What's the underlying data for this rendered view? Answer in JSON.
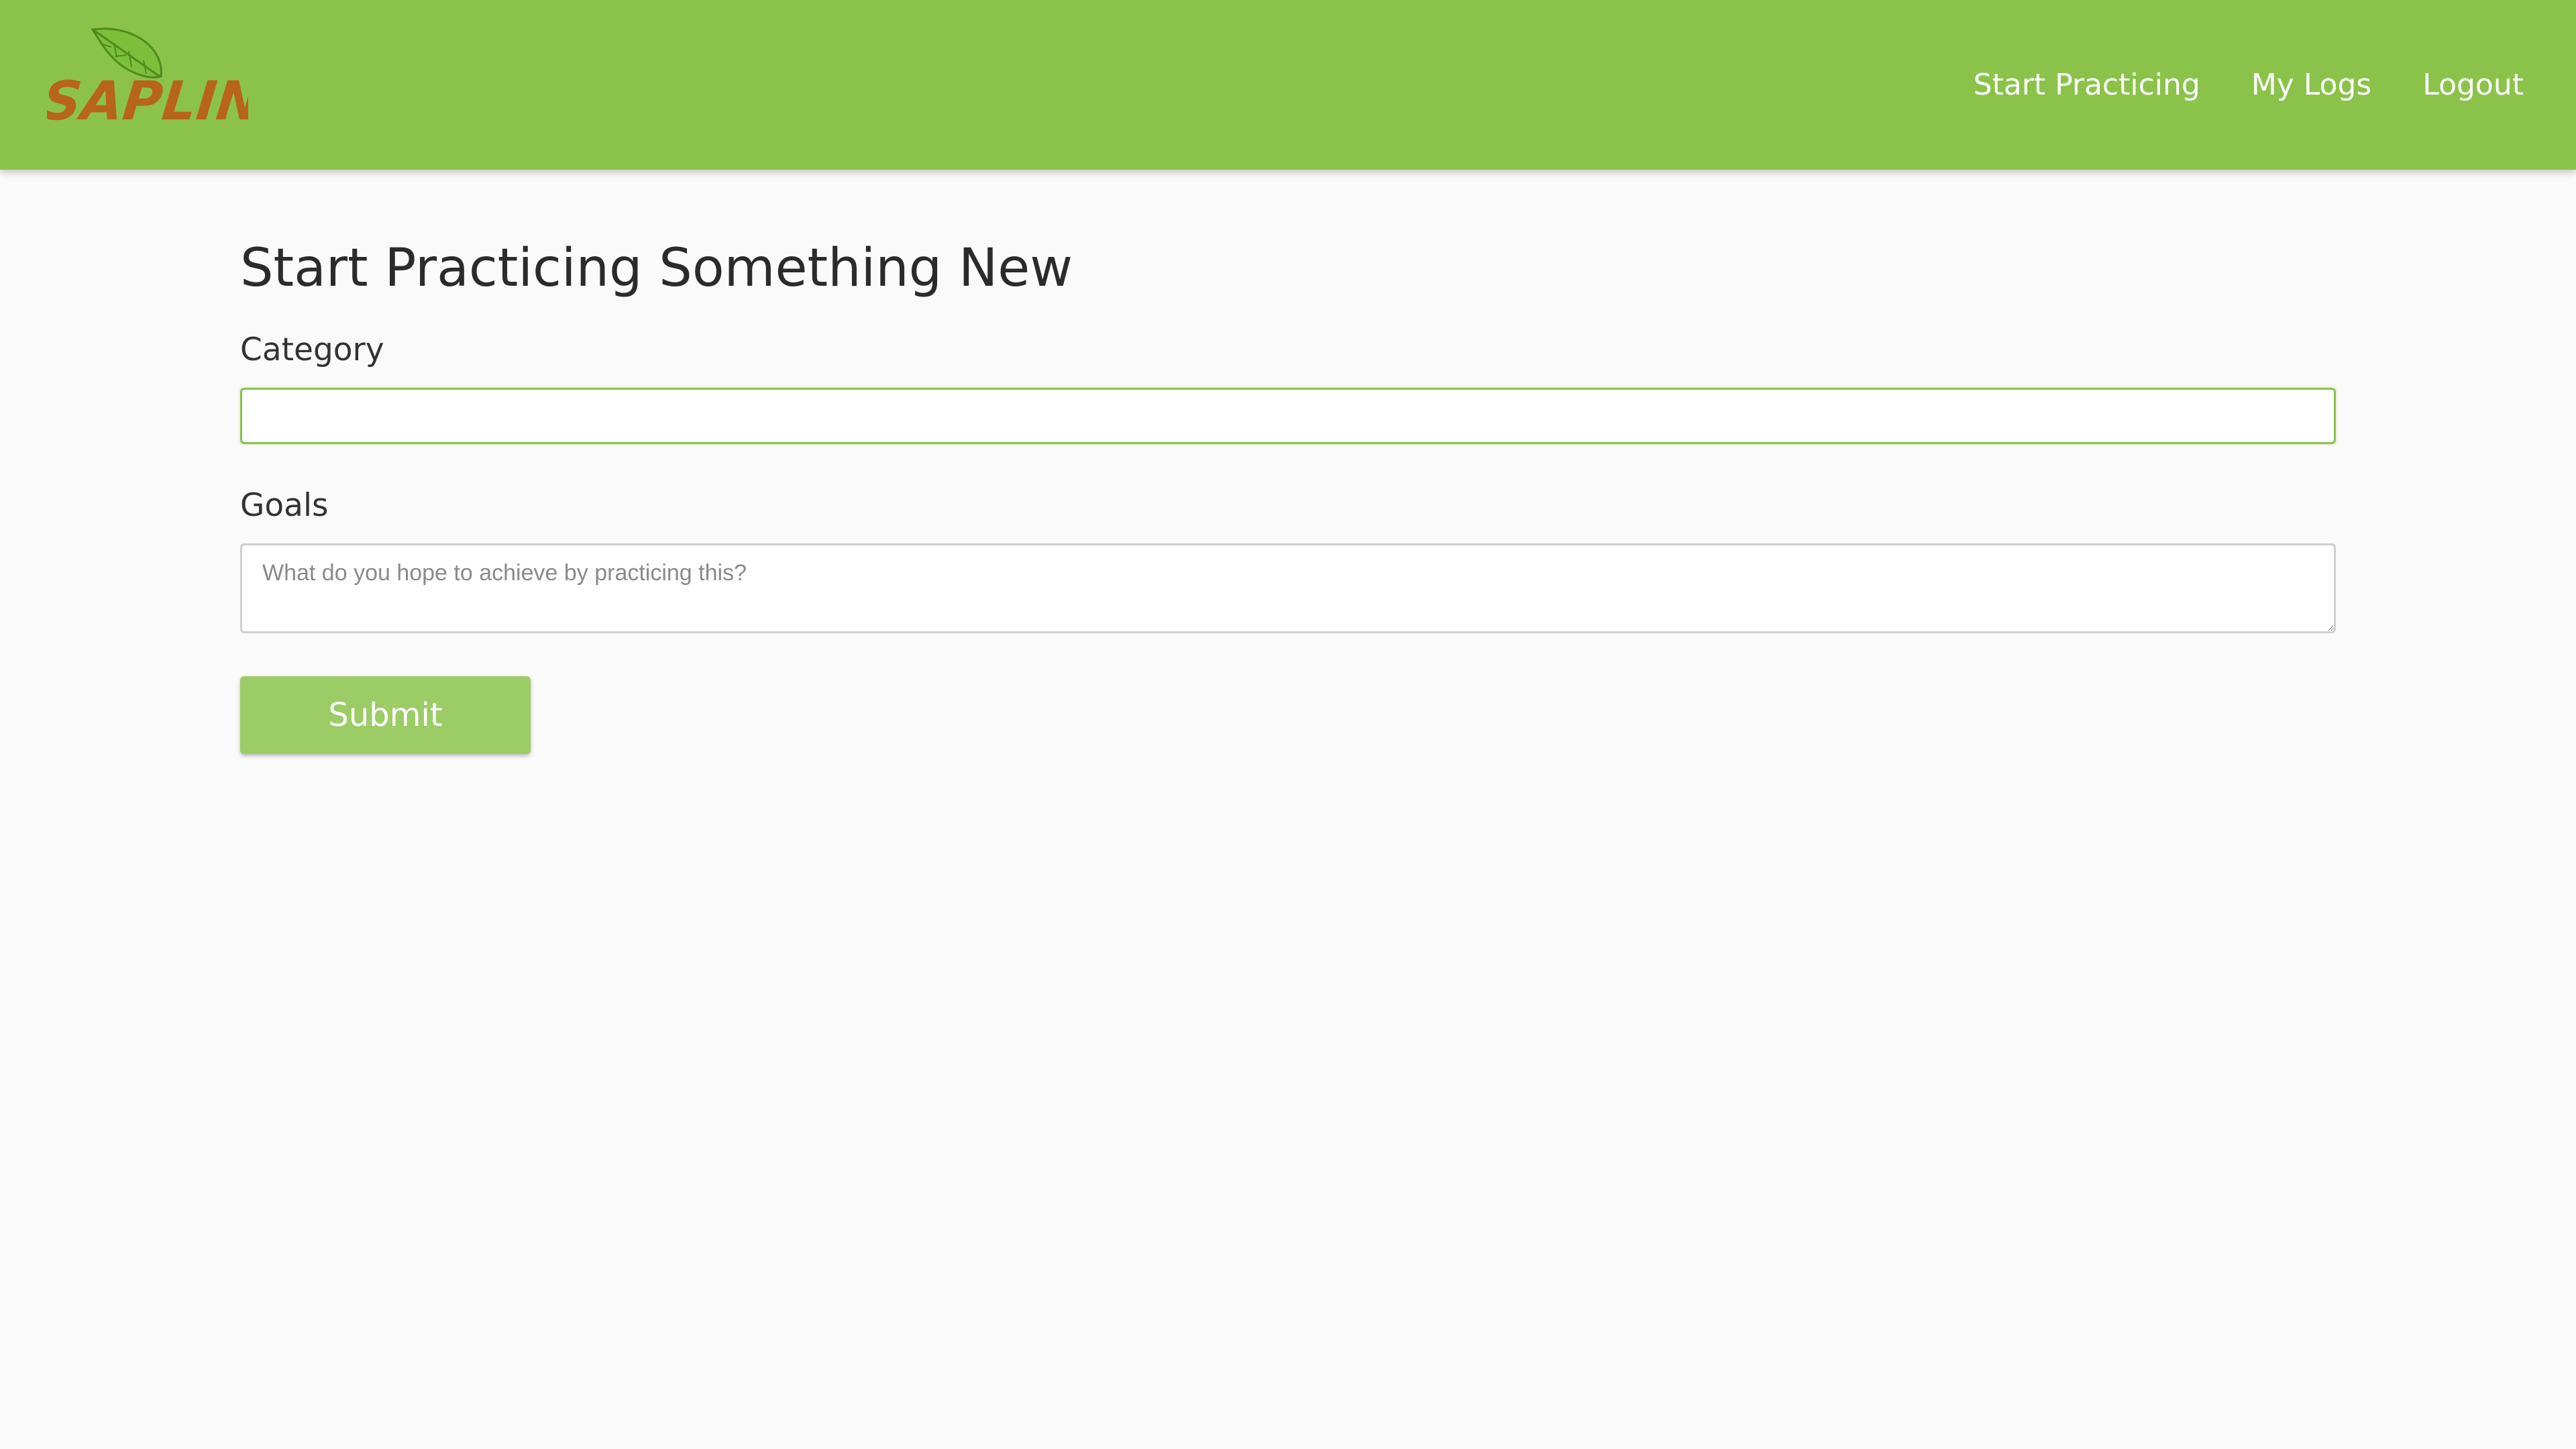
{
  "brand": {
    "logo_text": "SAPLING",
    "header_color": "#8bc34a",
    "logo_text_color": "#b8641a",
    "leaf_color": "#7cbf3a"
  },
  "nav": {
    "items": [
      {
        "label": "Start Practicing"
      },
      {
        "label": "My Logs"
      },
      {
        "label": "Logout"
      }
    ]
  },
  "page": {
    "title": "Start Practicing Something New"
  },
  "form": {
    "category_label": "Category",
    "category_value": "",
    "goals_label": "Goals",
    "goals_placeholder": "What do you hope to achieve by practicing this?",
    "submit_label": "Submit",
    "submit_color": "#9ccc65"
  }
}
